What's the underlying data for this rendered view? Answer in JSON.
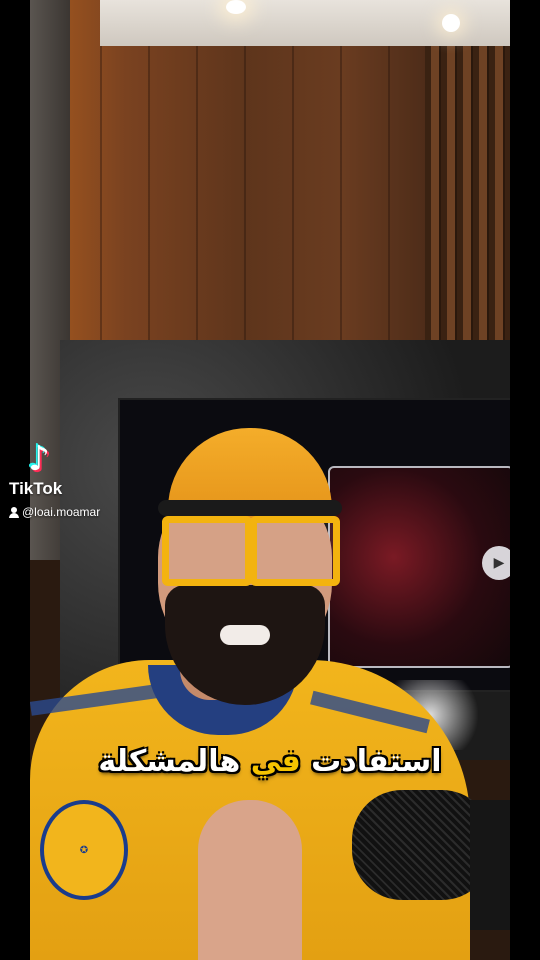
{
  "branding": {
    "logo_icon": "tiktok-note-icon",
    "wordmark": "TikTok",
    "username": "@loai.moamar"
  },
  "caption": {
    "part_before": "استفادت ",
    "highlight": "في",
    "part_after": " هالمشكلة",
    "highlight_color": "#f6c400"
  },
  "player": {
    "play_icon": "play-icon"
  },
  "colors": {
    "background": "#000000",
    "shirt": "#f2b51c",
    "caption_text": "#ffffff"
  }
}
